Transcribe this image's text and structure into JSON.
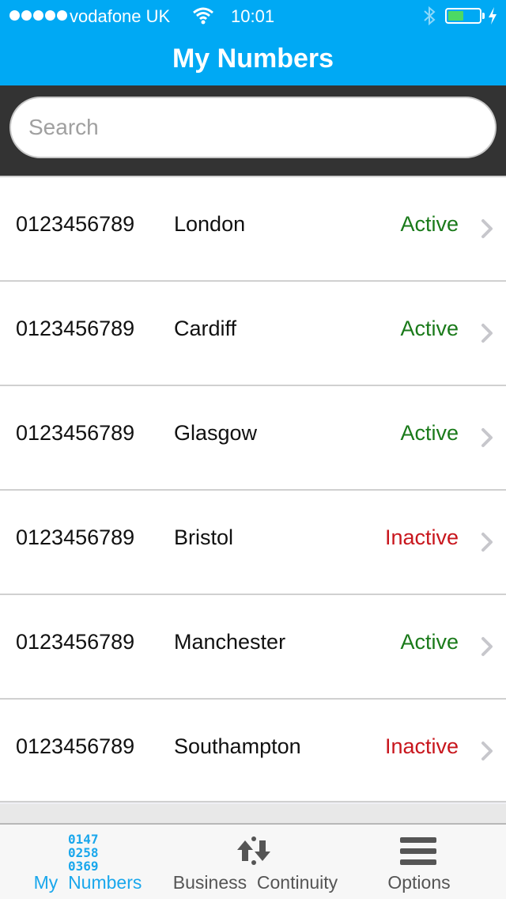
{
  "status_bar": {
    "carrier": "vodafone UK",
    "time": "10:01",
    "battery_level": 0.5,
    "battery_color": "#4cd964"
  },
  "nav": {
    "title": "My Numbers"
  },
  "search": {
    "placeholder": "Search",
    "value": ""
  },
  "rows": [
    {
      "number": "0123456789",
      "city": "London",
      "status": "Active"
    },
    {
      "number": "0123456789",
      "city": "Cardiff",
      "status": "Active"
    },
    {
      "number": "0123456789",
      "city": "Glasgow",
      "status": "Active"
    },
    {
      "number": "0123456789",
      "city": "Bristol",
      "status": "Inactive"
    },
    {
      "number": "0123456789",
      "city": "Manchester",
      "status": "Active"
    },
    {
      "number": "0123456789",
      "city": "Southampton",
      "status": "Inactive"
    }
  ],
  "colors": {
    "accent": "#00a9f4",
    "active": "#1a7a1a",
    "inactive": "#c8161d",
    "selected_tab": "#1aa7ec"
  },
  "tabs": [
    {
      "label": "My  Numbers",
      "icon": "number-grid-icon",
      "icon_text": [
        "0147",
        "0258",
        "0369"
      ],
      "selected": true
    },
    {
      "label": "Business  Continuity",
      "icon": "arrows-icon",
      "selected": false
    },
    {
      "label": "Options",
      "icon": "menu-icon",
      "selected": false
    }
  ]
}
